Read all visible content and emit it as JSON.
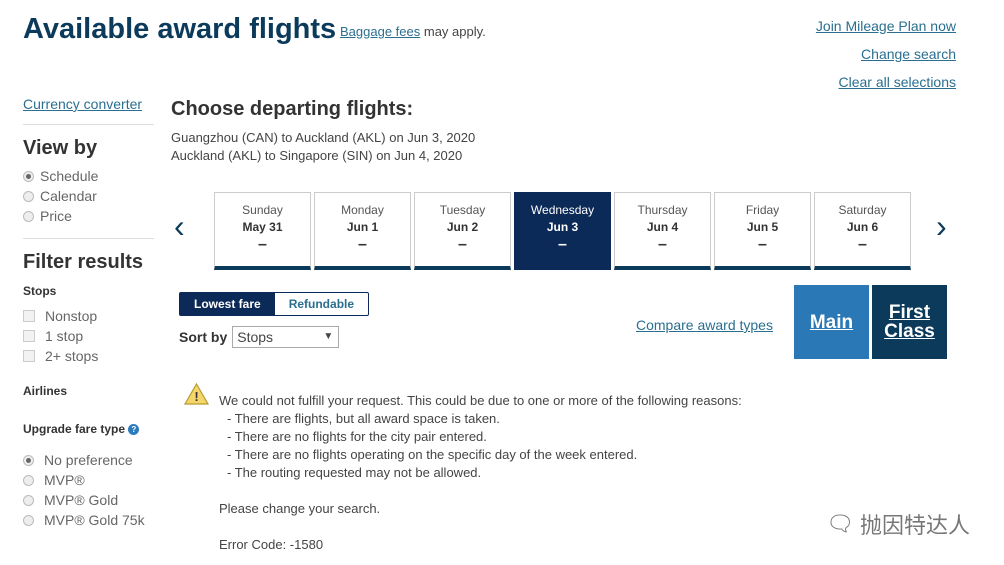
{
  "header": {
    "title": "Available award flights",
    "baggage_link": "Baggage fees",
    "baggage_suffix": "may apply.",
    "links": [
      "Join Mileage Plan now",
      "Change search",
      "Clear all selections"
    ]
  },
  "sidebar": {
    "currency": "Currency converter",
    "view_by": "View by",
    "view_options": [
      {
        "label": "Schedule",
        "selected": true
      },
      {
        "label": "Calendar",
        "selected": false
      },
      {
        "label": "Price",
        "selected": false
      }
    ],
    "filter_title": "Filter results",
    "stops_label": "Stops",
    "stops": [
      "Nonstop",
      "1 stop",
      "2+ stops"
    ],
    "airlines_label": "Airlines",
    "upgrade_label": "Upgrade fare type",
    "upgrade_options": [
      {
        "label": "No preference",
        "selected": true
      },
      {
        "label": "MVP®",
        "selected": false
      },
      {
        "label": "MVP® Gold",
        "selected": false
      },
      {
        "label": "MVP® Gold 75k",
        "selected": false
      }
    ]
  },
  "main": {
    "title": "Choose departing flights:",
    "routes": [
      "Guangzhou (CAN) to Auckland (AKL) on Jun 3, 2020",
      "Auckland (AKL) to Singapore (SIN) on Jun 4, 2020"
    ],
    "days": [
      {
        "dow": "Sunday",
        "date": "May 31",
        "price": "–"
      },
      {
        "dow": "Monday",
        "date": "Jun 1",
        "price": "–"
      },
      {
        "dow": "Tuesday",
        "date": "Jun 2",
        "price": "–"
      },
      {
        "dow": "Wednesday",
        "date": "Jun 3",
        "price": "–",
        "selected": true
      },
      {
        "dow": "Thursday",
        "date": "Jun 4",
        "price": "–"
      },
      {
        "dow": "Friday",
        "date": "Jun 5",
        "price": "–"
      },
      {
        "dow": "Saturday",
        "date": "Jun 6",
        "price": "–"
      }
    ],
    "fare_toggle": [
      "Lowest fare",
      "Refundable"
    ],
    "sort_label": "Sort by",
    "sort_value": "Stops",
    "compare": "Compare award types",
    "cabins": [
      {
        "label": "Main",
        "color": "#2a78b5"
      },
      {
        "label": "First Class",
        "color": "#0b3a5b"
      }
    ],
    "message": {
      "intro": "We could not fulfill your request. This could be due to one or more of the following reasons:",
      "reasons": [
        "- There are flights, but all award space is taken.",
        "- There are no flights for the city pair entered.",
        "- There are no flights operating on the specific day of the week entered.",
        "- The routing requested may not be allowed."
      ],
      "change": "Please change your search.",
      "error": "Error Code: -1580"
    }
  },
  "watermark": "抛因特达人"
}
